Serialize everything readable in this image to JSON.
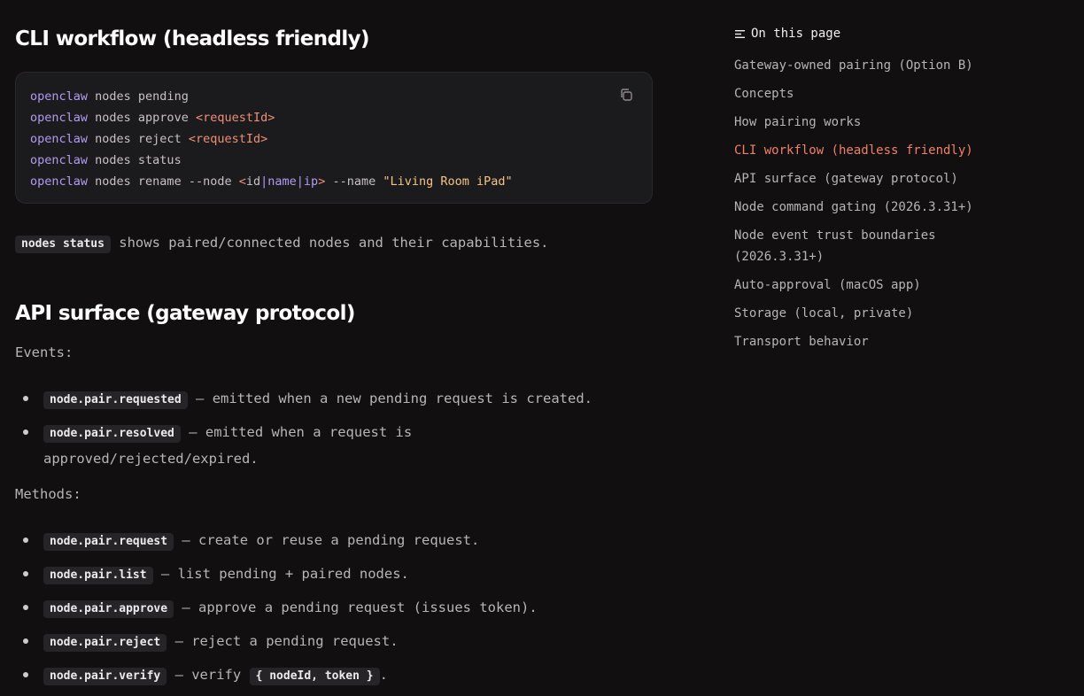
{
  "sections": {
    "cli_heading": "CLI workflow (headless friendly)",
    "api_heading": "API surface (gateway protocol)"
  },
  "code": {
    "lines": [
      {
        "cmd": "openclaw",
        "rest": " nodes pending"
      },
      {
        "cmd": "openclaw",
        "rest": " nodes approve ",
        "ph": "<requestId>"
      },
      {
        "cmd": "openclaw",
        "rest": " nodes reject ",
        "ph": "<requestId>"
      },
      {
        "cmd": "openclaw",
        "rest": " nodes status"
      },
      {
        "cmd": "openclaw",
        "rest": " nodes rename --node ",
        "ph_open": "<",
        "ph_id": "id",
        "pipe1": "|",
        "ph_name": "name",
        "pipe2": "|",
        "ph_ip": "ip",
        "ph_close": ">",
        "rest2": " --name ",
        "str": "\"Living Room iPad\""
      }
    ],
    "copy_label": "Copy"
  },
  "status_para": {
    "code": "nodes status",
    "text": " shows paired/connected nodes and their capabilities."
  },
  "events": {
    "label": "Events:",
    "items": [
      {
        "code": "node.pair.requested",
        "text": " — emitted when a new pending request is created."
      },
      {
        "code": "node.pair.resolved",
        "text": " — emitted when a request is approved/rejected/expired."
      }
    ]
  },
  "methods": {
    "label": "Methods:",
    "items": [
      {
        "code": "node.pair.request",
        "text": " — create or reuse a pending request."
      },
      {
        "code": "node.pair.list",
        "text": " — list pending + paired nodes."
      },
      {
        "code": "node.pair.approve",
        "text": " — approve a pending request (issues token)."
      },
      {
        "code": "node.pair.reject",
        "text": " — reject a pending request."
      },
      {
        "code": "node.pair.verify",
        "text": " — verify ",
        "code2": "{ nodeId, token }",
        "text2": "."
      }
    ]
  },
  "toc": {
    "title": "On this page",
    "items": [
      {
        "label": "Gateway-owned pairing (Option B)"
      },
      {
        "label": "Concepts"
      },
      {
        "label": "How pairing works"
      },
      {
        "label": "CLI workflow (headless friendly)",
        "active": true
      },
      {
        "label": "API surface (gateway protocol)"
      },
      {
        "label": "Node command gating (2026.3.31+)"
      },
      {
        "label": "Node event trust boundaries (2026.3.31+)"
      },
      {
        "label": "Auto-approval (macOS app)"
      },
      {
        "label": "Storage (local, private)"
      },
      {
        "label": "Transport behavior"
      }
    ]
  },
  "colors": {
    "background": "#120f11",
    "accent": "#ee8169",
    "command": "#b49cf2",
    "placeholder": "#ee8f79",
    "string": "#f4c58a"
  }
}
